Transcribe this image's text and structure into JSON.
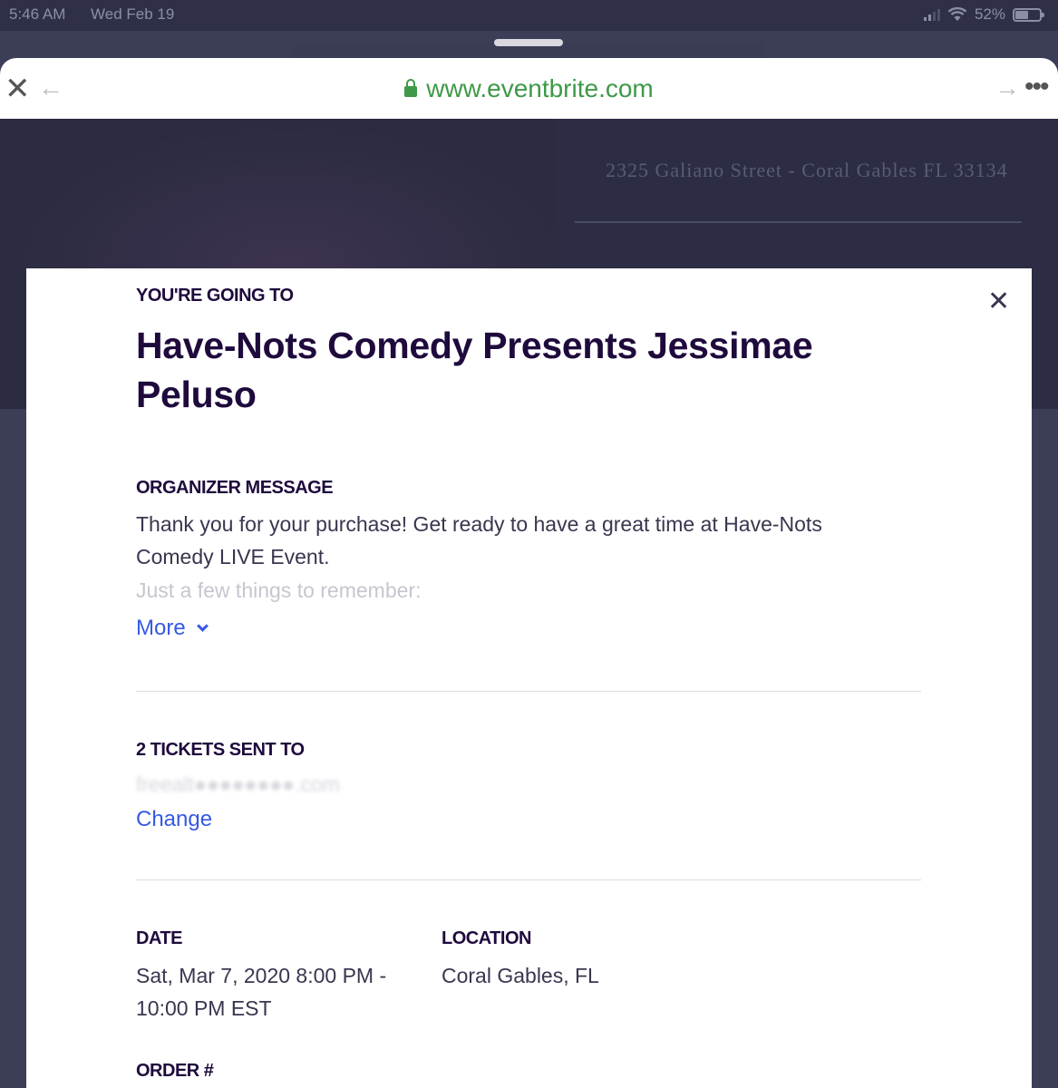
{
  "status_bar": {
    "time": "5:46 AM",
    "date": "Wed Feb 19",
    "battery": "52%",
    "battery_level": 0.52
  },
  "browser": {
    "url": "www.eventbrite.com"
  },
  "background_page": {
    "address": "2325 Galiano Street - Coral Gables FL 33134"
  },
  "modal": {
    "kicker": "YOU'RE GOING TO",
    "event_title": "Have-Nots Comedy Presents Jessimae Peluso",
    "organizer_label": "ORGANIZER MESSAGE",
    "organizer_line1": "Thank you for your purchase! Get ready to have a great time at Have-Nots Comedy LIVE Event.",
    "organizer_line2": "Just a few things to remember:",
    "more_label": "More",
    "tickets_label": "2 TICKETS SENT TO",
    "email_redacted": "freealt●●●●●●●●.com",
    "change_label": "Change",
    "date_label": "DATE",
    "date_value": "Sat, Mar 7, 2020 8:00 PM - 10:00 PM EST",
    "location_label": "LOCATION",
    "location_value": "Coral Gables, FL",
    "order_label": "ORDER #"
  }
}
